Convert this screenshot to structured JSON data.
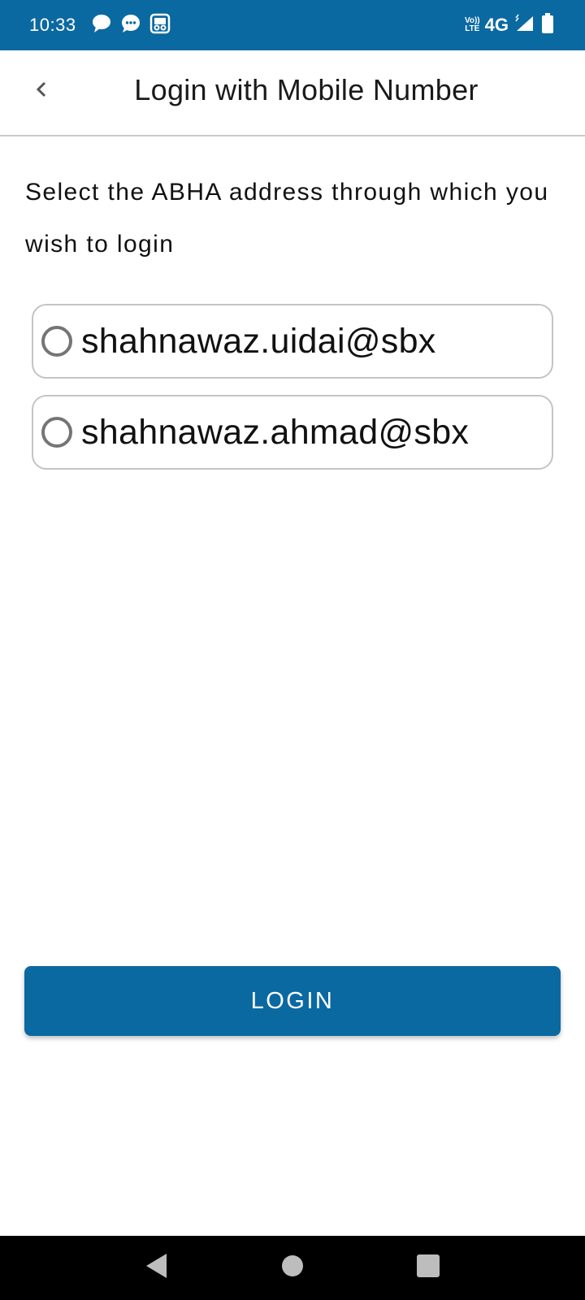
{
  "status_bar": {
    "time": "10:33",
    "network": "4G",
    "volte_top": "Vo))",
    "volte_bottom": "LTE",
    "background": "#0b69a1"
  },
  "app_bar": {
    "title": "Login with Mobile Number"
  },
  "instruction": "Select the ABHA address through which you wish to login",
  "options": [
    {
      "label": "shahnawaz.uidai@sbx",
      "selected": false
    },
    {
      "label": "shahnawaz.ahmad@sbx",
      "selected": false
    }
  ],
  "login_button": {
    "label": "LOGIN",
    "color": "#0b69a1"
  },
  "icons": {
    "status_left": [
      "chat-bubble-icon",
      "message-dots-icon",
      "screen-cast-icon"
    ],
    "status_right": [
      "volte-icon",
      "signal-icon",
      "battery-icon"
    ],
    "nav": [
      "back-triangle-icon",
      "home-circle-icon",
      "recents-square-icon"
    ]
  }
}
